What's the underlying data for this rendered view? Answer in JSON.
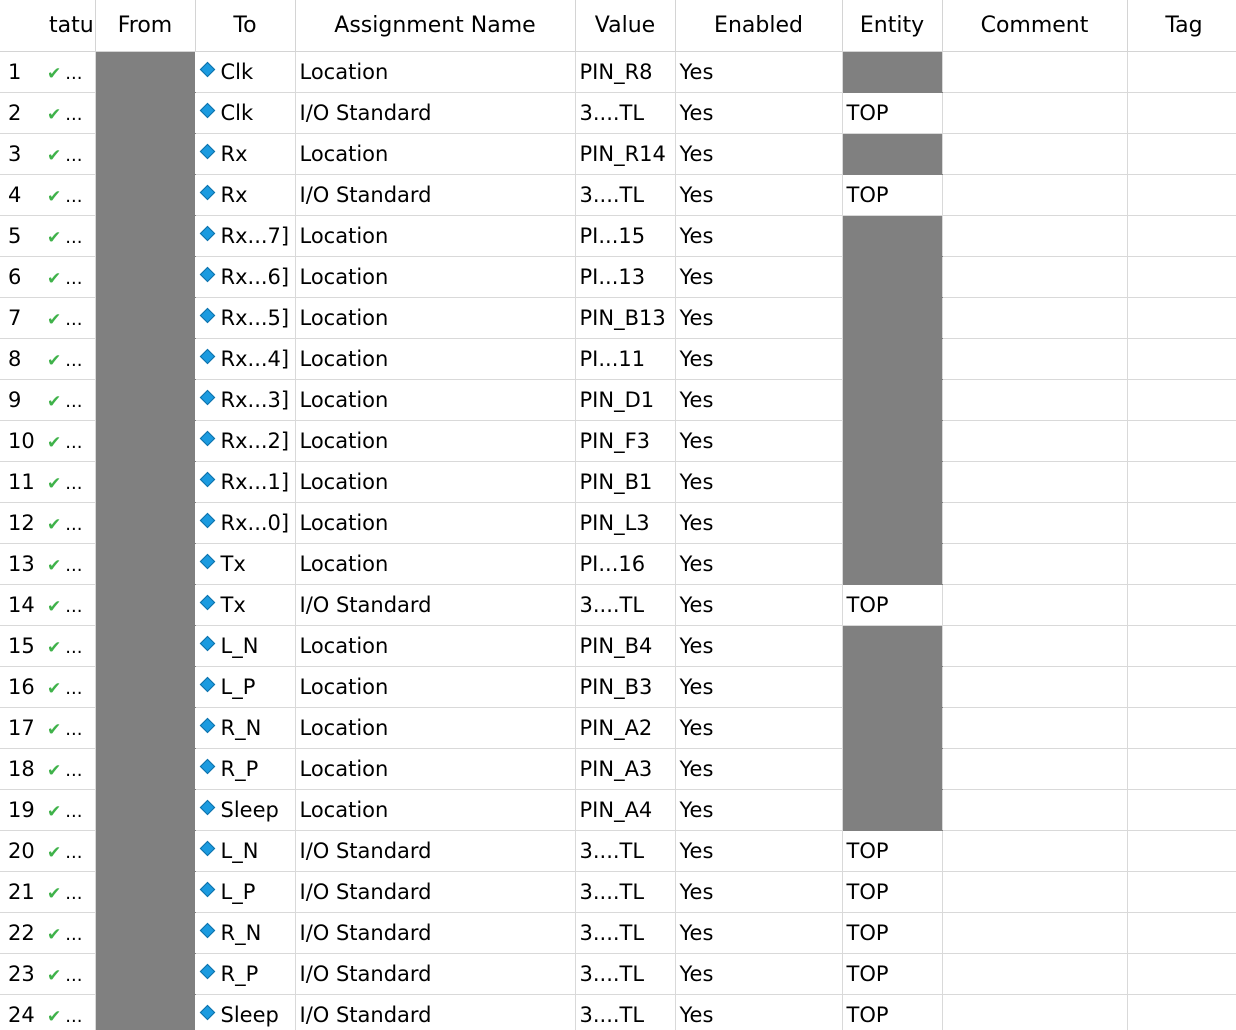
{
  "headers": {
    "num": "",
    "status": "tatu",
    "from": "From",
    "to": "To",
    "name": "Assignment Name",
    "value": "Value",
    "enabled": "Enabled",
    "entity": "Entity",
    "comment": "Comment",
    "tag": "Tag"
  },
  "status_icon": "checkmark-icon",
  "pin_icon": "pin-icon",
  "colors": {
    "check": "#3fb24a",
    "pin": "#1b9be0",
    "gray_cell": "#808080"
  },
  "rows": [
    {
      "num": "1",
      "status": "...",
      "to": "Clk",
      "name": "Location",
      "value": "PIN_R8",
      "enabled": "Yes",
      "entity": "",
      "entity_gray": true
    },
    {
      "num": "2",
      "status": "...",
      "to": "Clk",
      "name": "I/O Standard",
      "value": "3....TL",
      "enabled": "Yes",
      "entity": "TOP",
      "entity_gray": false
    },
    {
      "num": "3",
      "status": "...",
      "to": "Rx",
      "name": "Location",
      "value": "PIN_R14",
      "enabled": "Yes",
      "entity": "",
      "entity_gray": true
    },
    {
      "num": "4",
      "status": "...",
      "to": "Rx",
      "name": "I/O Standard",
      "value": "3....TL",
      "enabled": "Yes",
      "entity": "TOP",
      "entity_gray": false
    },
    {
      "num": "5",
      "status": "...",
      "to": "Rx...7]",
      "name": "Location",
      "value": "PI...15",
      "enabled": "Yes",
      "entity": "",
      "entity_gray": true
    },
    {
      "num": "6",
      "status": "...",
      "to": "Rx...6]",
      "name": "Location",
      "value": "PI...13",
      "enabled": "Yes",
      "entity": "",
      "entity_gray": true
    },
    {
      "num": "7",
      "status": "...",
      "to": "Rx...5]",
      "name": "Location",
      "value": "PIN_B13",
      "enabled": "Yes",
      "entity": "",
      "entity_gray": true
    },
    {
      "num": "8",
      "status": "...",
      "to": "Rx...4]",
      "name": "Location",
      "value": "PI...11",
      "enabled": "Yes",
      "entity": "",
      "entity_gray": true
    },
    {
      "num": "9",
      "status": "...",
      "to": "Rx...3]",
      "name": "Location",
      "value": "PIN_D1",
      "enabled": "Yes",
      "entity": "",
      "entity_gray": true
    },
    {
      "num": "10",
      "status": "...",
      "to": "Rx...2]",
      "name": "Location",
      "value": "PIN_F3",
      "enabled": "Yes",
      "entity": "",
      "entity_gray": true
    },
    {
      "num": "11",
      "status": "...",
      "to": "Rx...1]",
      "name": "Location",
      "value": "PIN_B1",
      "enabled": "Yes",
      "entity": "",
      "entity_gray": true
    },
    {
      "num": "12",
      "status": "...",
      "to": "Rx...0]",
      "name": "Location",
      "value": "PIN_L3",
      "enabled": "Yes",
      "entity": "",
      "entity_gray": true
    },
    {
      "num": "13",
      "status": "...",
      "to": "Tx",
      "name": "Location",
      "value": "PI...16",
      "enabled": "Yes",
      "entity": "",
      "entity_gray": true
    },
    {
      "num": "14",
      "status": "...",
      "to": "Tx",
      "name": "I/O Standard",
      "value": "3....TL",
      "enabled": "Yes",
      "entity": "TOP",
      "entity_gray": false
    },
    {
      "num": "15",
      "status": "...",
      "to": "L_N",
      "name": "Location",
      "value": "PIN_B4",
      "enabled": "Yes",
      "entity": "",
      "entity_gray": true
    },
    {
      "num": "16",
      "status": "...",
      "to": "L_P",
      "name": "Location",
      "value": "PIN_B3",
      "enabled": "Yes",
      "entity": "",
      "entity_gray": true
    },
    {
      "num": "17",
      "status": "...",
      "to": "R_N",
      "name": "Location",
      "value": "PIN_A2",
      "enabled": "Yes",
      "entity": "",
      "entity_gray": true
    },
    {
      "num": "18",
      "status": "...",
      "to": "R_P",
      "name": "Location",
      "value": "PIN_A3",
      "enabled": "Yes",
      "entity": "",
      "entity_gray": true
    },
    {
      "num": "19",
      "status": "...",
      "to": "Sleep",
      "name": "Location",
      "value": "PIN_A4",
      "enabled": "Yes",
      "entity": "",
      "entity_gray": true
    },
    {
      "num": "20",
      "status": "...",
      "to": "L_N",
      "name": "I/O Standard",
      "value": "3....TL",
      "enabled": "Yes",
      "entity": "TOP",
      "entity_gray": false
    },
    {
      "num": "21",
      "status": "...",
      "to": "L_P",
      "name": "I/O Standard",
      "value": "3....TL",
      "enabled": "Yes",
      "entity": "TOP",
      "entity_gray": false
    },
    {
      "num": "22",
      "status": "...",
      "to": "R_N",
      "name": "I/O Standard",
      "value": "3....TL",
      "enabled": "Yes",
      "entity": "TOP",
      "entity_gray": false
    },
    {
      "num": "23",
      "status": "...",
      "to": "R_P",
      "name": "I/O Standard",
      "value": "3....TL",
      "enabled": "Yes",
      "entity": "TOP",
      "entity_gray": false
    },
    {
      "num": "24",
      "status": "...",
      "to": "Sleep",
      "name": "I/O Standard",
      "value": "3....TL",
      "enabled": "Yes",
      "entity": "TOP",
      "entity_gray": false
    }
  ]
}
